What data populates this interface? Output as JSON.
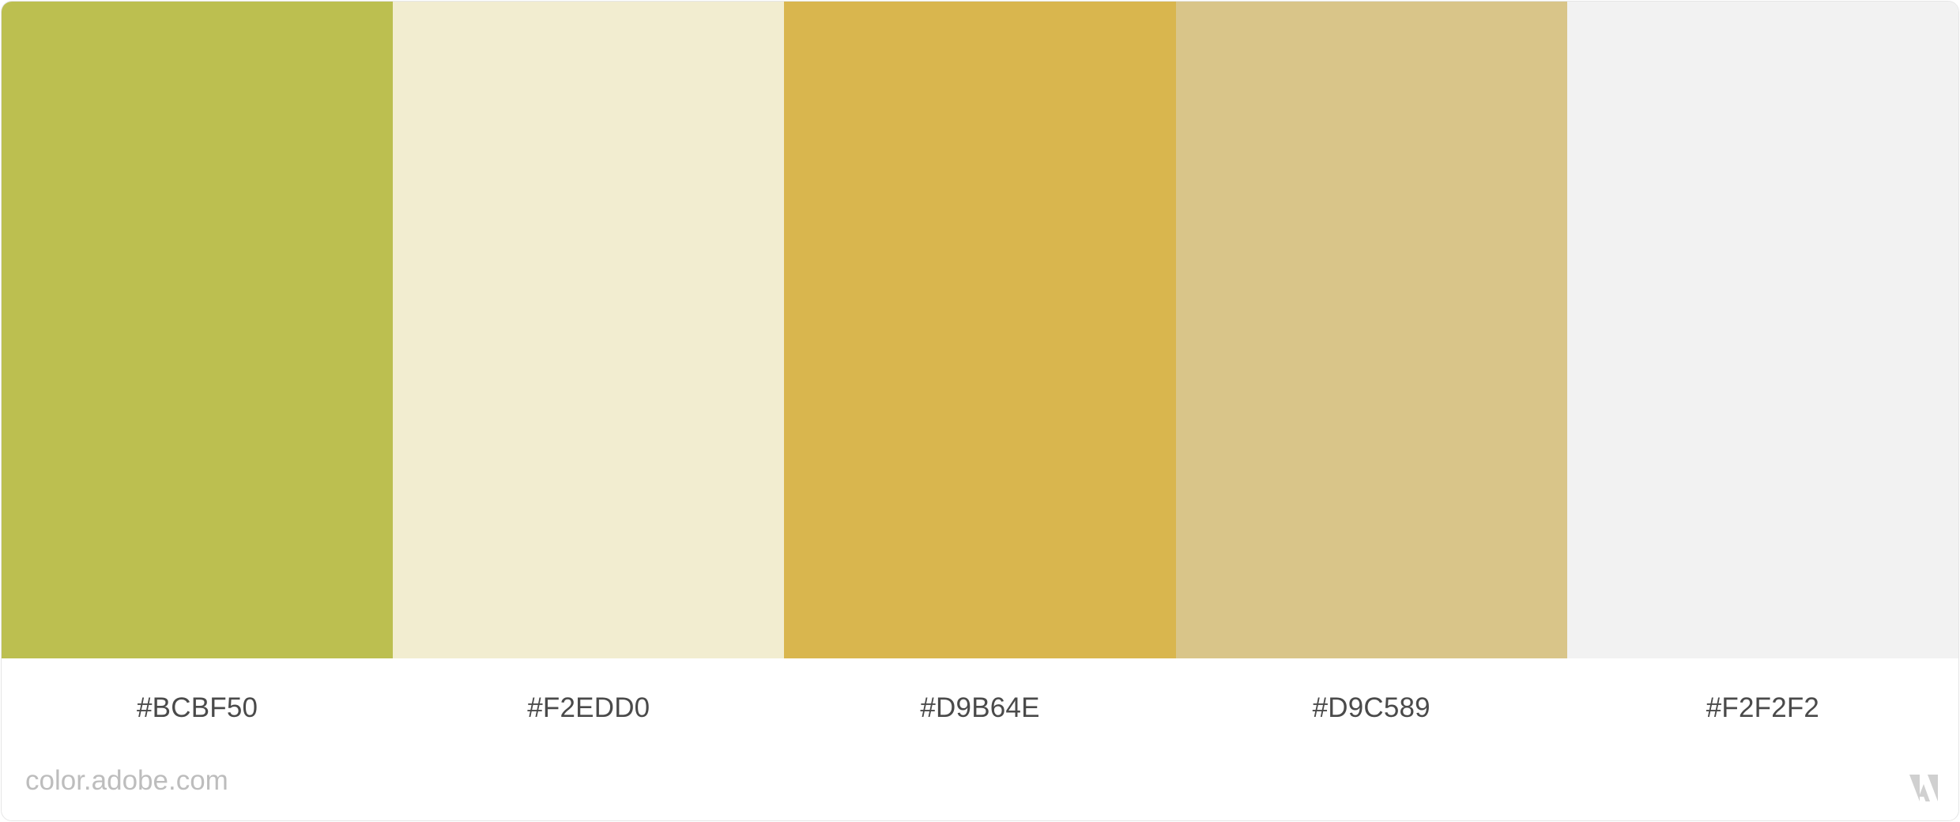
{
  "swatches": [
    {
      "color": "#BCBF50",
      "label": "#BCBF50"
    },
    {
      "color": "#F2EDD0",
      "label": "#F2EDD0"
    },
    {
      "color": "#D9B64E",
      "label": "#D9B64E"
    },
    {
      "color": "#D9C589",
      "label": "#D9C589"
    },
    {
      "color": "#F2F2F2",
      "label": "#F2F2F2"
    }
  ],
  "footer": {
    "site": "color.adobe.com",
    "logo_icon": "adobe-logo-icon",
    "logo_color": "#d0d0d0"
  }
}
